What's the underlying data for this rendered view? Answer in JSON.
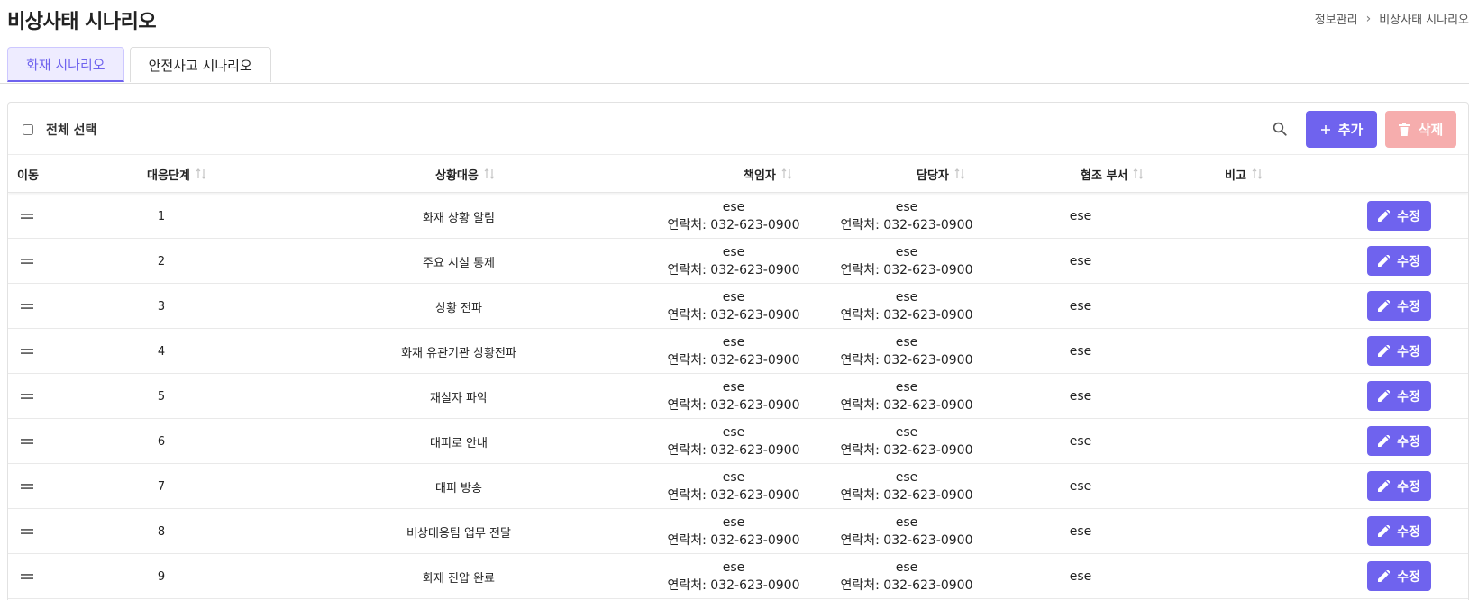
{
  "page": {
    "title": "비상사태 시나리오",
    "breadcrumb": [
      "정보관리",
      "비상사태 시나리오"
    ],
    "breadcrumb_sep": "›"
  },
  "tabs": [
    {
      "label": "화재 시나리오",
      "active": true
    },
    {
      "label": "안전사고 시나리오",
      "active": false
    }
  ],
  "toolbar": {
    "select_all_label": "전체 선택",
    "add_label": "추가",
    "delete_label": "삭제",
    "search_icon": "search-icon"
  },
  "table": {
    "headers": {
      "move": "이동",
      "stage": "대응단계",
      "action": "상황대응",
      "owner": "책임자",
      "manager": "담당자",
      "dept": "협조 부서",
      "note": "비고"
    },
    "edit_label": "수정",
    "rows": [
      {
        "stage": "1",
        "action": "화재 상황 알림",
        "owner": "ese",
        "owner_contact": "연락처: 032-623-0900",
        "manager": "ese",
        "manager_contact": "연락처: 032-623-0900",
        "dept": "ese",
        "note": ""
      },
      {
        "stage": "2",
        "action": "주요 시설 통제",
        "owner": "ese",
        "owner_contact": "연락처: 032-623-0900",
        "manager": "ese",
        "manager_contact": "연락처: 032-623-0900",
        "dept": "ese",
        "note": ""
      },
      {
        "stage": "3",
        "action": "상황 전파",
        "owner": "ese",
        "owner_contact": "연락처: 032-623-0900",
        "manager": "ese",
        "manager_contact": "연락처: 032-623-0900",
        "dept": "ese",
        "note": ""
      },
      {
        "stage": "4",
        "action": "화재 유관기관 상황전파",
        "owner": "ese",
        "owner_contact": "연락처: 032-623-0900",
        "manager": "ese",
        "manager_contact": "연락처: 032-623-0900",
        "dept": "ese",
        "note": ""
      },
      {
        "stage": "5",
        "action": "재실자 파악",
        "owner": "ese",
        "owner_contact": "연락처: 032-623-0900",
        "manager": "ese",
        "manager_contact": "연락처: 032-623-0900",
        "dept": "ese",
        "note": ""
      },
      {
        "stage": "6",
        "action": "대피로 안내",
        "owner": "ese",
        "owner_contact": "연락처: 032-623-0900",
        "manager": "ese",
        "manager_contact": "연락처: 032-623-0900",
        "dept": "ese",
        "note": ""
      },
      {
        "stage": "7",
        "action": "대피 방송",
        "owner": "ese",
        "owner_contact": "연락처: 032-623-0900",
        "manager": "ese",
        "manager_contact": "연락처: 032-623-0900",
        "dept": "ese",
        "note": ""
      },
      {
        "stage": "8",
        "action": "비상대응팀 업무 전달",
        "owner": "ese",
        "owner_contact": "연락처: 032-623-0900",
        "manager": "ese",
        "manager_contact": "연락처: 032-623-0900",
        "dept": "ese",
        "note": ""
      },
      {
        "stage": "9",
        "action": "화재 진압 완료",
        "owner": "ese",
        "owner_contact": "연락처: 032-623-0900",
        "manager": "ese",
        "manager_contact": "연락처: 032-623-0900",
        "dept": "ese",
        "note": ""
      }
    ]
  },
  "colors": {
    "accent": "#6f63ee",
    "accent_light": "#eeecff",
    "danger_disabled": "#f6adad"
  }
}
